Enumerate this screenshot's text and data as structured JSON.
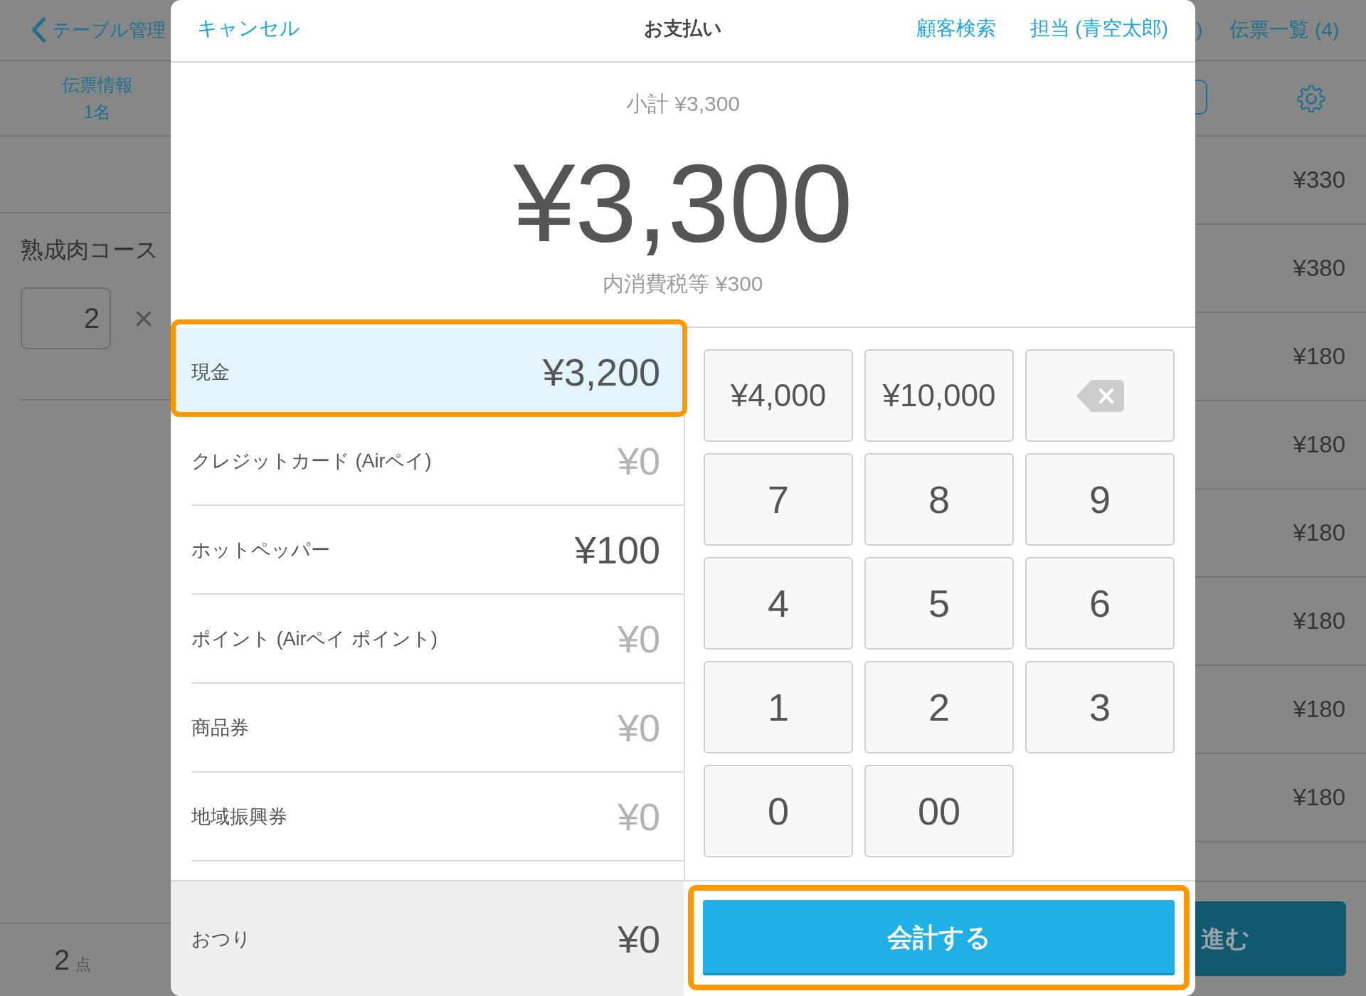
{
  "background": {
    "top_bar": {
      "back": "テーブル管理",
      "cut_text": ")",
      "slips": "伝票一覧 (4)"
    },
    "slip_info": {
      "title": "伝票情報",
      "guests": "1名"
    },
    "order_item": {
      "name": "熟成肉コース",
      "quantity": "2",
      "remove": "×"
    },
    "prices": [
      "¥330",
      "¥380",
      "¥180",
      "¥180",
      "¥180",
      "¥180",
      "¥180",
      "¥180"
    ],
    "item_count": {
      "count": "2",
      "unit": "点"
    },
    "proceed_button": "進む"
  },
  "payment_dialog": {
    "cancel": "キャンセル",
    "title": "お支払い",
    "actions": [
      "顧客検索",
      "担当 (青空太郎)"
    ],
    "subtotal": "小計 ¥3,300",
    "total": "¥3,300",
    "tax": "内消費税等 ¥300",
    "payment_methods": [
      {
        "name": "現金",
        "amount": "¥3,200",
        "selected": true,
        "entered": true,
        "highlighted": true
      },
      {
        "name": "クレジットカード (Airペイ)",
        "amount": "¥0",
        "selected": false,
        "entered": false,
        "highlighted": false
      },
      {
        "name": "ホットペッパー",
        "amount": "¥100",
        "selected": false,
        "entered": true,
        "highlighted": false
      },
      {
        "name": "ポイント (Airペイ ポイント)",
        "amount": "¥0",
        "selected": false,
        "entered": false,
        "highlighted": false
      },
      {
        "name": "商品券",
        "amount": "¥0",
        "selected": false,
        "entered": false,
        "highlighted": false
      },
      {
        "name": "地域振興券",
        "amount": "¥0",
        "selected": false,
        "entered": false,
        "highlighted": false
      }
    ],
    "change": {
      "label": "おつり",
      "amount": "¥0"
    },
    "keypad": [
      {
        "kind": "amount",
        "label": "¥4,000"
      },
      {
        "kind": "amount",
        "label": "¥10,000"
      },
      {
        "kind": "backspace"
      },
      {
        "kind": "digit",
        "label": "7"
      },
      {
        "kind": "digit",
        "label": "8"
      },
      {
        "kind": "digit",
        "label": "9"
      },
      {
        "kind": "digit",
        "label": "4"
      },
      {
        "kind": "digit",
        "label": "5"
      },
      {
        "kind": "digit",
        "label": "6"
      },
      {
        "kind": "digit",
        "label": "1"
      },
      {
        "kind": "digit",
        "label": "2"
      },
      {
        "kind": "digit",
        "label": "3"
      },
      {
        "kind": "digit",
        "label": "0"
      },
      {
        "kind": "digit",
        "label": "00"
      }
    ],
    "checkout_button": {
      "label": "会計する",
      "highlighted": true
    }
  }
}
